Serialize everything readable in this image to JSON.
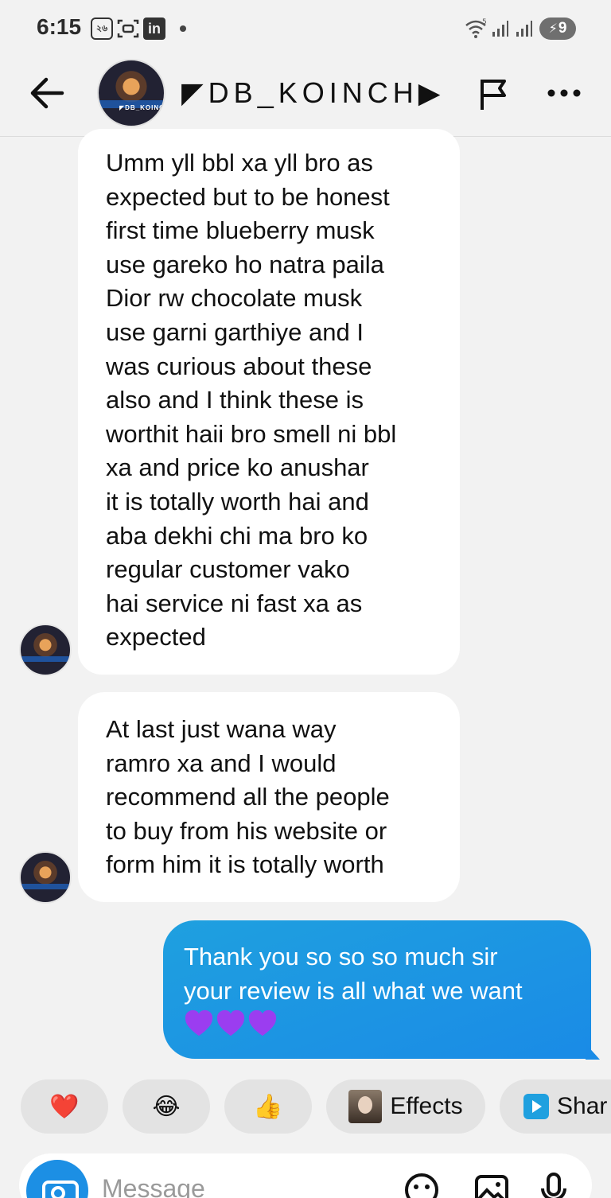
{
  "status_bar": {
    "time": "6:15",
    "icons": [
      "carrier-badge-icon",
      "screenshot-icon",
      "linkedin-icon",
      "notification-dot-icon",
      "wifi-icon",
      "signal-icon",
      "signal-icon"
    ],
    "carrier_badge": "২৬",
    "linkedin_label": "in",
    "battery_level": "9",
    "wifi_label": "5"
  },
  "header": {
    "title": "◤DB_KOINCH▶",
    "avatar_caption": "◤DB_KOINCH",
    "icons": [
      "back-arrow-icon",
      "flag-icon",
      "more-icon"
    ]
  },
  "messages": {
    "incoming": [
      {
        "text": "Umm yll bbl xa yll bro as\nexpected but to be honest\nfirst time blueberry musk\nuse gareko ho natra paila\nDior rw chocolate musk\nuse garni garthiye and I\nwas curious about these\nalso and I think these is\nworthit haii bro smell ni bbl\nxa and price ko anushar\nit is totally worth hai and\naba dekhi chi ma bro ko\nregular customer vako\nhai service ni fast xa as\nexpected"
      },
      {
        "text": "At last just wana way\nramro xa and I would\nrecommend all the people\nto buy from his website or\nform him it is totally worth"
      }
    ],
    "outgoing": {
      "text": "Thank you so so so much sir\nyour review is all what we want",
      "emoji_count": 3,
      "emoji": "purple-heart"
    }
  },
  "quick_reactions": {
    "heart": "❤️",
    "laugh": "😂",
    "thumbs": "👍",
    "effects_label": "Effects",
    "share_label": "Shar"
  },
  "composer": {
    "placeholder": "Message",
    "icons": [
      "camera-icon",
      "sticker-icon",
      "gallery-icon",
      "mic-icon"
    ]
  },
  "colors": {
    "background": "#f2f2f2",
    "outgoing_bubble": "#1a8be6",
    "incoming_bubble": "#ffffff",
    "purple_heart": "#9b3df0"
  }
}
